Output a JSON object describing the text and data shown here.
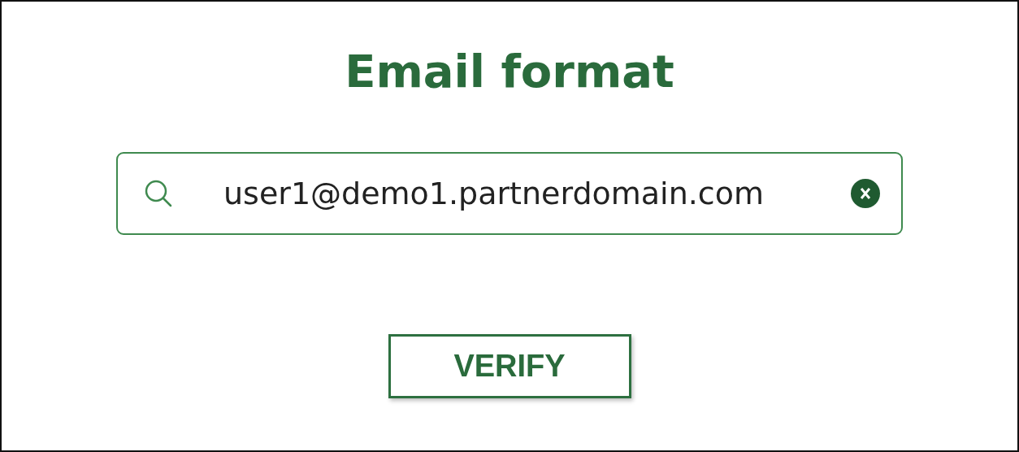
{
  "title": "Email format",
  "search": {
    "value": "user1@demo1.partnerdomain.com"
  },
  "buttons": [
    "VERIFY"
  ]
}
